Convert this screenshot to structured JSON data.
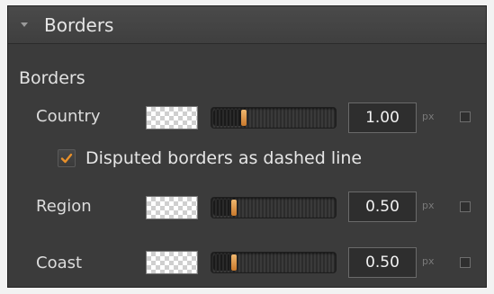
{
  "panel": {
    "header_title": "Borders",
    "expanded": true
  },
  "section_title": "Borders",
  "rows": [
    {
      "label": "Country",
      "value": "1.00",
      "unit": "px",
      "slider_fraction": 0.25,
      "checked": false
    },
    {
      "label": "Region",
      "value": "0.50",
      "unit": "px",
      "slider_fraction": 0.17,
      "checked": false
    },
    {
      "label": "Coast",
      "value": "0.50",
      "unit": "px",
      "slider_fraction": 0.17,
      "checked": false
    }
  ],
  "disputed_option": {
    "label": "Disputed borders as dashed line",
    "checked": true
  },
  "colors": {
    "panel_bg": "#3b3b3b",
    "accent_orange": "#e8902a",
    "text": "#e2e2e2"
  }
}
